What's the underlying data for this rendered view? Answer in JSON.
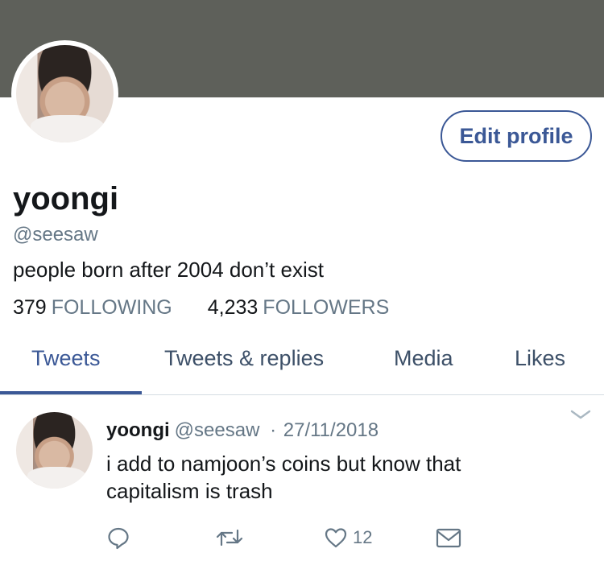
{
  "profile": {
    "name": "yoongi",
    "handle": "@seesaw",
    "bio": "people born after 2004 don’t exist",
    "edit_button": "Edit profile",
    "following_count": "379",
    "following_label": "FOLLOWING",
    "followers_count": "4,233",
    "followers_label": "FOLLOWERS"
  },
  "tabs": [
    {
      "label": "Tweets",
      "active": true
    },
    {
      "label": "Tweets & replies",
      "active": false
    },
    {
      "label": "Media",
      "active": false
    },
    {
      "label": "Likes",
      "active": false
    }
  ],
  "tweet": {
    "name": "yoongi",
    "handle": "@seesaw",
    "separator": "·",
    "date": "27/11/2018",
    "text": "i add to namjoon’s coins but know that capitalism is trash",
    "like_count": "12",
    "icons": [
      "reply-icon",
      "retweet-icon",
      "like-icon",
      "message-icon",
      "chevron-down-icon"
    ]
  },
  "colors": {
    "banner": "#5e605a",
    "accent": "#3b5896",
    "muted": "#657786",
    "text": "#14171a"
  }
}
